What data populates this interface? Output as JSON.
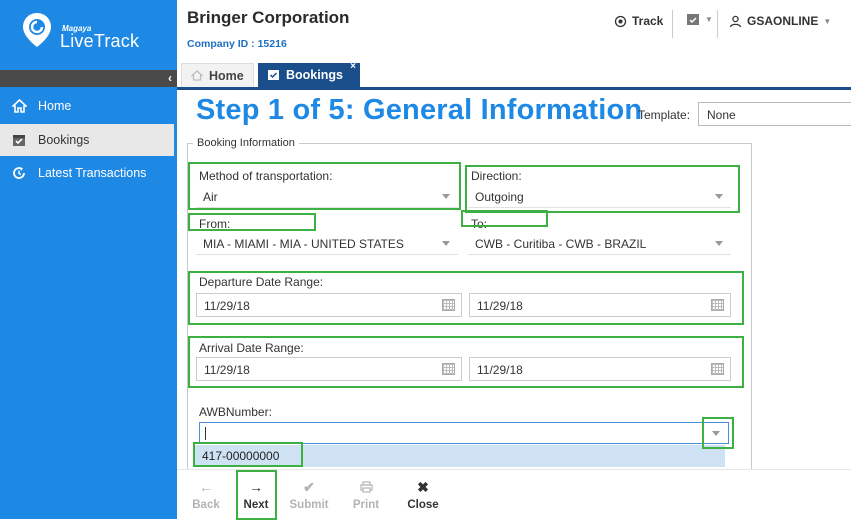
{
  "brand": {
    "small": "Magaya",
    "big": "LiveTrack"
  },
  "sidebar": {
    "items": [
      {
        "label": "Home",
        "icon": "home-icon"
      },
      {
        "label": "Bookings",
        "icon": "calendar-check-icon",
        "active": true
      },
      {
        "label": "Latest Transactions",
        "icon": "refresh-clock-icon"
      }
    ]
  },
  "header": {
    "company": "Bringer Corporation",
    "company_id": "Company ID : 15216",
    "track_label": "Track",
    "user_label": "GSAONLINE"
  },
  "tabs": [
    {
      "label": "Home"
    },
    {
      "label": "Bookings",
      "active": true,
      "close": "×"
    }
  ],
  "page": {
    "title": "Step 1 of 5: General Information",
    "template_label": "Template:",
    "template_value": "None"
  },
  "form": {
    "legend": "Booking Information",
    "method_label": "Method of transportation:",
    "method_value": "Air",
    "direction_label": "Direction:",
    "direction_value": "Outgoing",
    "from_label": "From:",
    "from_value": "MIA - MIAMI - MIA - UNITED STATES",
    "to_label": "To:",
    "to_value": "CWB - Curitiba - CWB - BRAZIL",
    "departure_label": "Departure Date Range:",
    "departure_from": "11/29/18",
    "departure_to": "11/29/18",
    "arrival_label": "Arrival Date Range:",
    "arrival_from": "11/29/18",
    "arrival_to": "11/29/18",
    "awb_label": "AWBNumber:",
    "awb_value": "",
    "awb_suggestion": "417-00000000"
  },
  "toolbar": {
    "back": "Back",
    "next": "Next",
    "submit": "Submit",
    "print": "Print",
    "close": "Close"
  },
  "colors": {
    "sidebar": "#1e88e5",
    "tab_active": "#1a4f8b",
    "highlight": "#3cb043",
    "title": "#1e88e5"
  }
}
